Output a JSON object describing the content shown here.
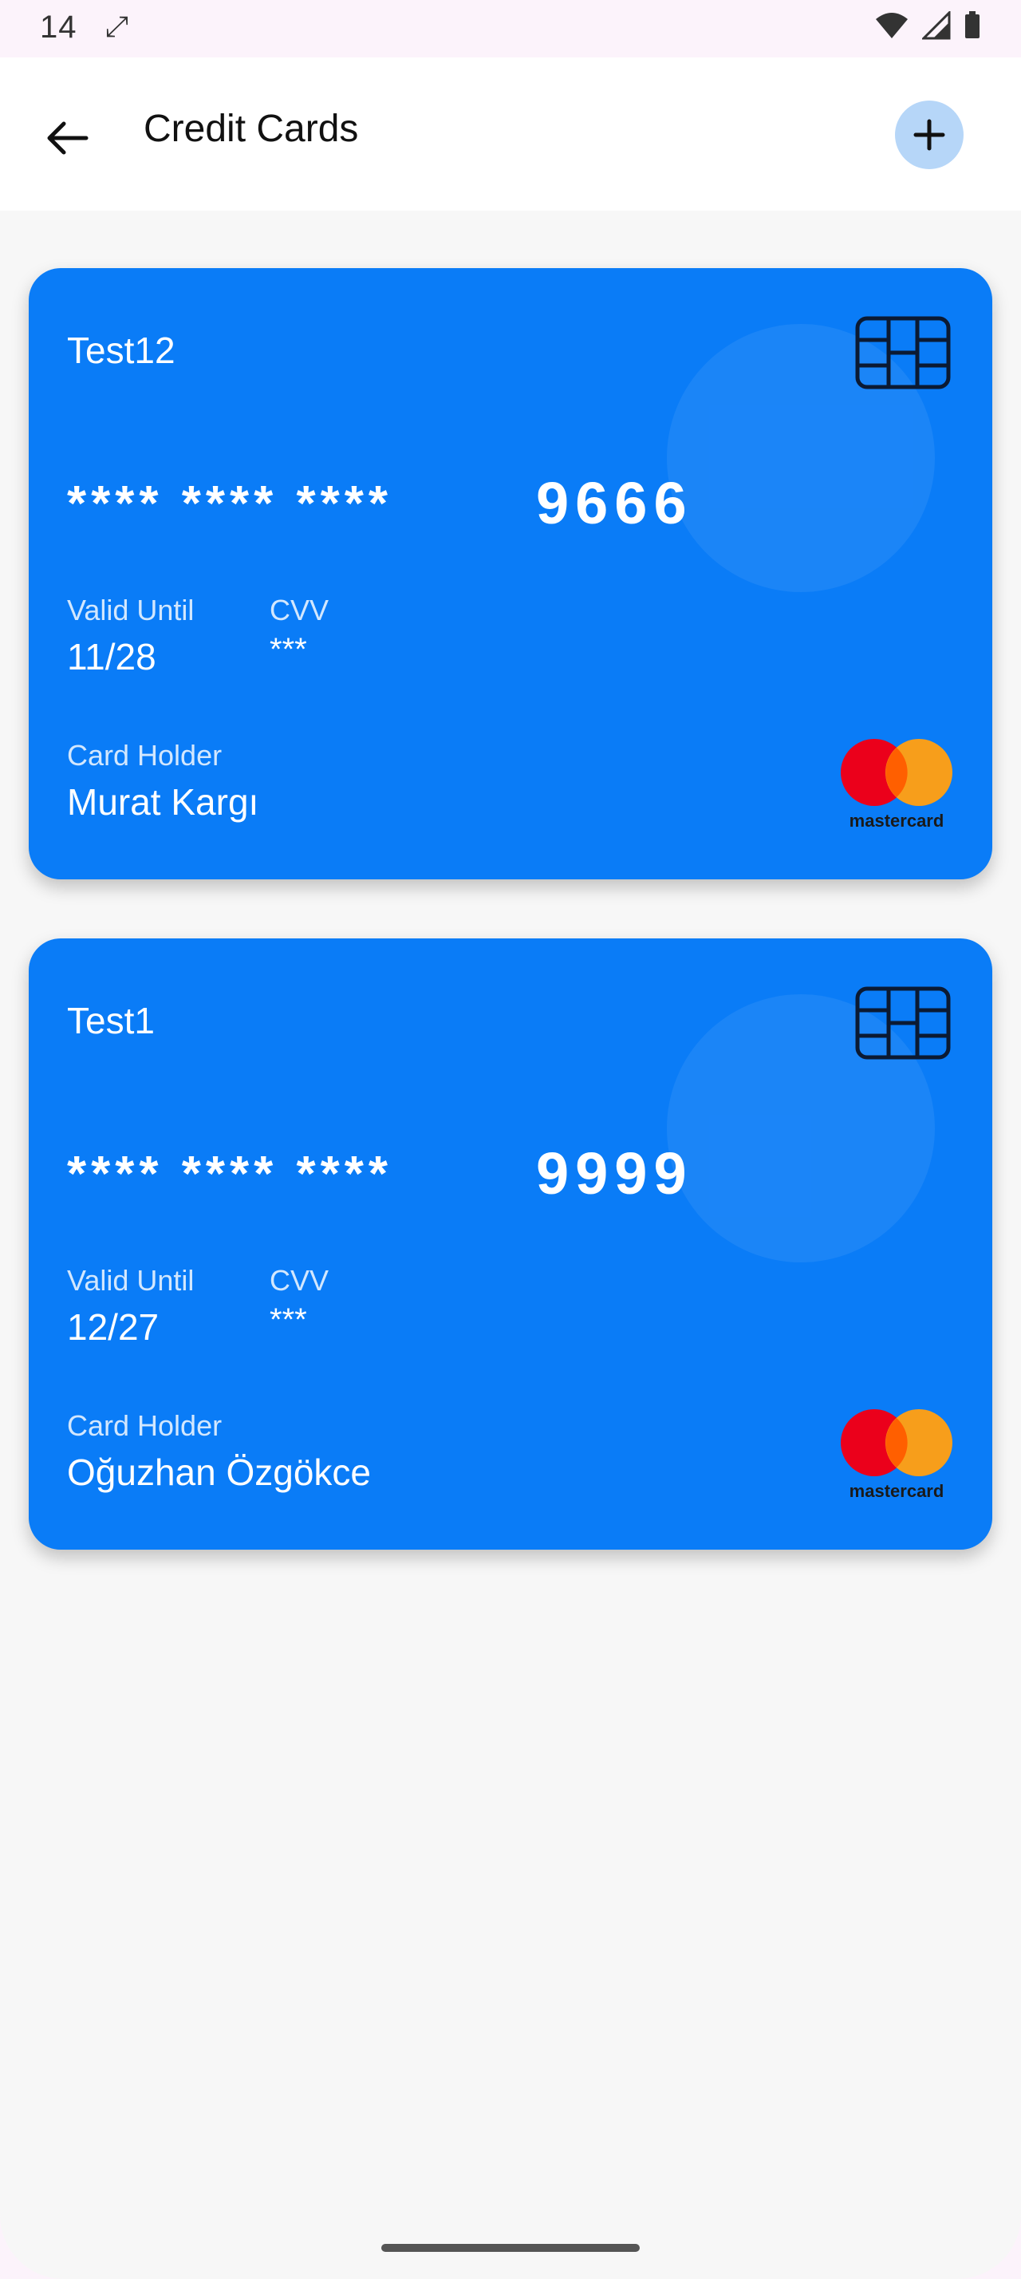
{
  "status": {
    "time": "14",
    "colors": {
      "icons": "#333333"
    }
  },
  "app_bar": {
    "title": "Credit Cards",
    "back_icon": "arrow-left-icon",
    "add_icon": "plus-icon",
    "add_color": "#b6d6f8"
  },
  "cards": [
    {
      "name": "Test12",
      "number_mask": "**** **** ****",
      "last4": "9666",
      "valid_label": "Valid Until",
      "valid": "11/28",
      "cvv_label": "CVV",
      "cvv": "***",
      "holder_label": "Card Holder",
      "holder": "Murat Kargı",
      "brand": "mastercard"
    },
    {
      "name": "Test1",
      "number_mask": "**** **** ****",
      "last4": "9999",
      "valid_label": "Valid Until",
      "valid": "12/27",
      "cvv_label": "CVV",
      "cvv": "***",
      "holder_label": "Card Holder",
      "holder": "Oğuzhan Özgökce",
      "brand": "mastercard"
    }
  ],
  "theme": {
    "card_color": "#0a7cf7",
    "background": "#f7f7f7"
  }
}
